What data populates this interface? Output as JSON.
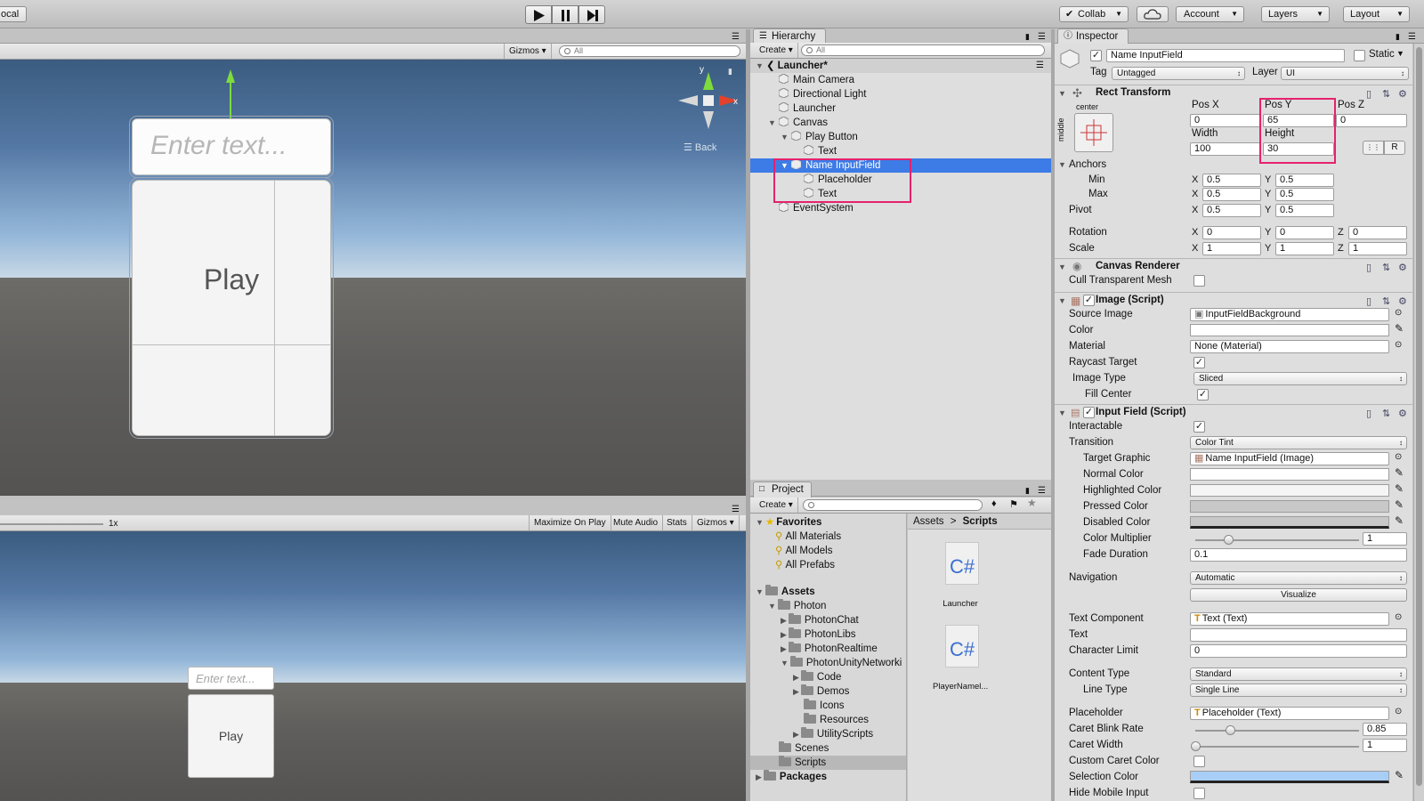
{
  "toolbar": {
    "local_label": "ocal",
    "collab_label": "Collab",
    "account_label": "Account",
    "layers_label": "Layers",
    "layout_label": "Layout"
  },
  "scene": {
    "gizmos_label": "Gizmos",
    "search_placeholder": "All",
    "back_label": "Back",
    "axis_y": "y",
    "axis_x": "x",
    "input_placeholder": "Enter text...",
    "play_label": "Play"
  },
  "game": {
    "scale_label": "1x",
    "maximize_label": "Maximize On Play",
    "mute_label": "Mute Audio",
    "stats_label": "Stats",
    "gizmos_label": "Gizmos",
    "input_placeholder": "Enter text...",
    "play_label": "Play"
  },
  "hierarchy": {
    "tab": "Hierarchy",
    "create": "Create",
    "search_placeholder": "All",
    "root": "Launcher*",
    "items": [
      "Main Camera",
      "Directional Light",
      "Launcher",
      "Canvas",
      "Play Button",
      "Text",
      "Name InputField",
      "Placeholder",
      "Text",
      "EventSystem"
    ]
  },
  "project": {
    "tab": "Project",
    "create": "Create",
    "favorites": "Favorites",
    "fav_items": [
      "All Materials",
      "All Models",
      "All Prefabs"
    ],
    "assets": "Assets",
    "tree": [
      "Photon",
      "PhotonChat",
      "PhotonLibs",
      "PhotonRealtime",
      "PhotonUnityNetworki",
      "Code",
      "Demos",
      "Icons",
      "Resources",
      "UtilityScripts",
      "Scenes",
      "Scripts"
    ],
    "packages": "Packages",
    "breadcrumb": [
      "Assets",
      "Scripts"
    ],
    "files": [
      "Launcher",
      "PlayerNamel..."
    ],
    "cs_glyph": "C#"
  },
  "inspector": {
    "tab": "Inspector",
    "object_name": "Name InputField",
    "static_label": "Static",
    "tag_label": "Tag",
    "tag_value": "Untagged",
    "layer_label": "Layer",
    "layer_value": "UI",
    "rect": {
      "title": "Rect Transform",
      "anchor_h": "center",
      "anchor_v": "middle",
      "posx_label": "Pos X",
      "posy_label": "Pos Y",
      "posz_label": "Pos Z",
      "posx": "0",
      "posy": "65",
      "posz": "0",
      "width_label": "Width",
      "height_label": "Height",
      "width": "100",
      "height": "30",
      "r_label": "R",
      "anchors_label": "Anchors",
      "min_label": "Min",
      "max_label": "Max",
      "pivot_label": "Pivot",
      "rotation_label": "Rotation",
      "scale_label": "Scale",
      "x": "X",
      "y": "Y",
      "z": "Z",
      "min_x": "0.5",
      "min_y": "0.5",
      "max_x": "0.5",
      "max_y": "0.5",
      "pivot_x": "0.5",
      "pivot_y": "0.5",
      "rot_x": "0",
      "rot_y": "0",
      "rot_z": "0",
      "scale_x": "1",
      "scale_y": "1",
      "scale_z": "1"
    },
    "canvas_renderer": {
      "title": "Canvas Renderer",
      "cull_label": "Cull Transparent Mesh"
    },
    "image": {
      "title": "Image (Script)",
      "source_label": "Source Image",
      "source_value": "InputFieldBackground",
      "color_label": "Color",
      "material_label": "Material",
      "material_value": "None (Material)",
      "raycast_label": "Raycast Target",
      "type_label": "Image Type",
      "type_value": "Sliced",
      "fill_label": "Fill Center"
    },
    "input": {
      "title": "Input Field (Script)",
      "interactable_label": "Interactable",
      "transition_label": "Transition",
      "transition_value": "Color Tint",
      "target_label": "Target Graphic",
      "target_value": "Name InputField (Image)",
      "normal_label": "Normal Color",
      "highlight_label": "Highlighted Color",
      "pressed_label": "Pressed Color",
      "disabled_label": "Disabled Color",
      "multiplier_label": "Color Multiplier",
      "multiplier_value": "1",
      "multiplier_level": 1,
      "fade_label": "Fade Duration",
      "fade_value": "0.1",
      "nav_label": "Navigation",
      "nav_value": "Automatic",
      "visualize_label": "Visualize",
      "textcomp_label": "Text Component",
      "textcomp_value": "Text (Text)",
      "text_label": "Text",
      "text_value": "",
      "charlimit_label": "Character Limit",
      "charlimit_value": "0",
      "content_label": "Content Type",
      "content_value": "Standard",
      "line_label": "Line Type",
      "line_value": "Single Line",
      "placeholder_label": "Placeholder",
      "placeholder_value": "Placeholder (Text)",
      "blink_label": "Caret Blink Rate",
      "blink_value": "0.85",
      "blink_level": 0.85,
      "caretw_label": "Caret Width",
      "caretw_value": "1",
      "caretw_level": 1,
      "custom_caret_label": "Custom Caret Color",
      "selection_label": "Selection Color",
      "hide_mobile_label": "Hide Mobile Input"
    }
  },
  "colors": {
    "selection": "#3d7be7",
    "highlight_box": "#e5226d",
    "selection_color_swatch": "#a8cef8"
  }
}
